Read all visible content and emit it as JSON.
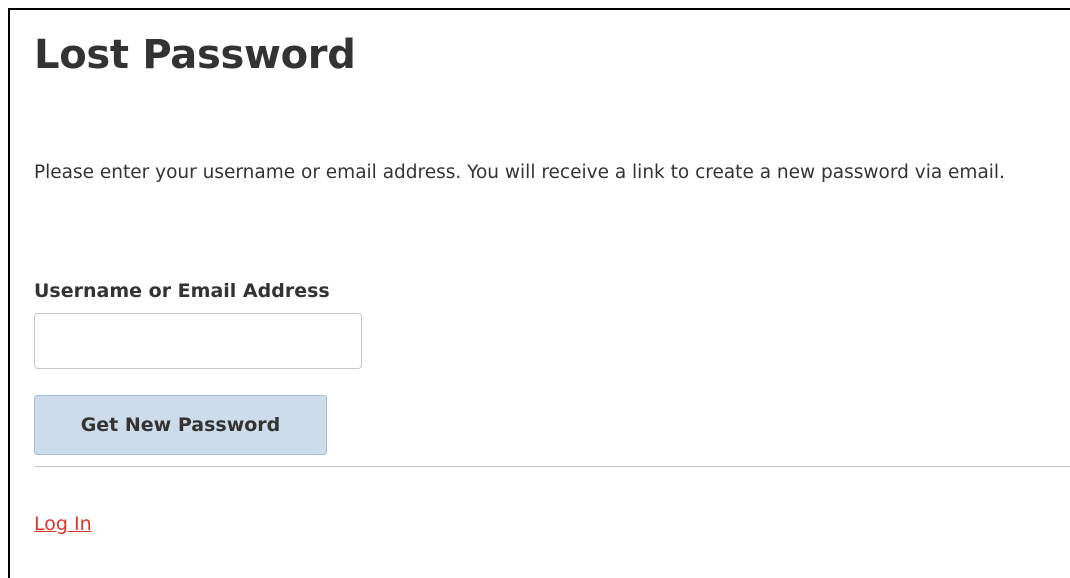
{
  "page": {
    "title": "Lost Password",
    "intro": "Please enter your username or email address. You will receive a link to create a new password via email."
  },
  "form": {
    "field_label": "Username or Email Address",
    "field_value": "",
    "field_placeholder": "",
    "submit_label": "Get New Password"
  },
  "footer": {
    "login_link": "Log In"
  },
  "colors": {
    "text": "#333333",
    "button_bg": "#ccdceb",
    "link": "#d8382b",
    "divider": "#c8c8c8"
  }
}
